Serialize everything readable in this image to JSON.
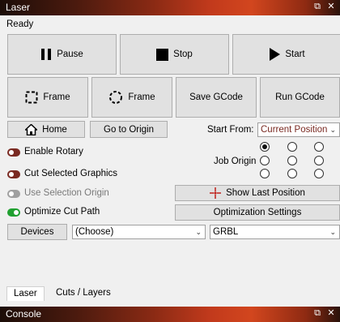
{
  "laser_window": {
    "title": "Laser"
  },
  "console_window": {
    "title": "Console"
  },
  "status_text": "Ready",
  "actions": {
    "pause": "Pause",
    "stop": "Stop",
    "start": "Start"
  },
  "frame_row": {
    "frame_rect": "Frame",
    "frame_round": "Frame",
    "save_gcode": "Save GCode",
    "run_gcode": "Run GCode"
  },
  "nav": {
    "home": "Home",
    "go_to_origin": "Go to Origin"
  },
  "start_from": {
    "label": "Start From:",
    "selected": "Current Position"
  },
  "job_origin": {
    "label": "Job Origin",
    "selected_index": 0
  },
  "options": {
    "enable_rotary": "Enable Rotary",
    "cut_selected_graphics": "Cut Selected Graphics",
    "use_selection_origin": "Use Selection Origin",
    "optimize_cut_path": "Optimize Cut Path"
  },
  "buttons": {
    "show_last_position": "Show Last Position",
    "optimization_settings": "Optimization Settings",
    "devices": "Devices"
  },
  "device_select": {
    "selected": "(Choose)"
  },
  "controller_select": {
    "selected": "GRBL"
  },
  "tabs": [
    {
      "label": "Laser",
      "active": true
    },
    {
      "label": "Cuts / Layers",
      "active": false
    }
  ],
  "colors": {
    "title_dark": "#1c0d08",
    "title_accent": "#c23a1c",
    "toggle_red": "#7a2a22",
    "toggle_green": "#20a030"
  }
}
